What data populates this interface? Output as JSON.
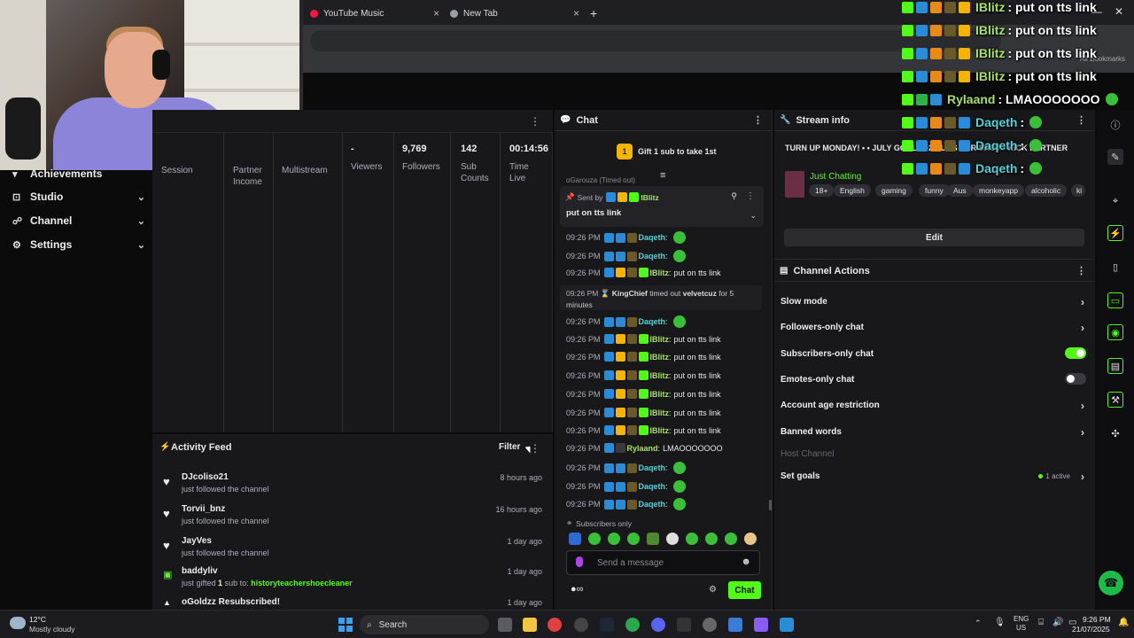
{
  "tabs": [
    {
      "label": "YouTube Music",
      "color": "#ff1744"
    },
    {
      "label": "New Tab",
      "color": "#9aa0a6"
    }
  ],
  "bookmarks_label": "All Bookmarks",
  "sidebar": {
    "items": [
      {
        "label": "Achievements",
        "icon": "trophy-icon"
      },
      {
        "label": "Studio",
        "icon": "studio-icon"
      },
      {
        "label": "Channel",
        "icon": "people-icon"
      },
      {
        "label": "Settings",
        "icon": "gear-icon"
      }
    ]
  },
  "stats": {
    "columns": [
      {
        "value": "",
        "label": "Session"
      },
      {
        "value": "",
        "label": "Partner Income"
      },
      {
        "value": "",
        "label": "Multistream"
      },
      {
        "value": "-",
        "label": "Viewers"
      },
      {
        "value": "9,769",
        "label": "Followers"
      },
      {
        "value": "142",
        "label": "Sub Counts"
      },
      {
        "value": "00:14:56",
        "label": "Time Live"
      }
    ]
  },
  "activity": {
    "title": "Activity Feed",
    "filter_label": "Filter",
    "items": [
      {
        "name": "DJcoliso21",
        "desc": "just followed the channel",
        "time": "8 hours ago",
        "kind": "follow"
      },
      {
        "name": "Torvii_bnz",
        "desc": "just followed the channel",
        "time": "16 hours ago",
        "kind": "follow"
      },
      {
        "name": "JayVes",
        "desc": "just followed the channel",
        "time": "1 day ago",
        "kind": "follow"
      },
      {
        "name": "baddyliv",
        "desc_prefix": "just gifted",
        "desc_count": "1",
        "desc_mid": "sub to:",
        "desc_target": "historyteachershoecleaner",
        "time": "1 day ago",
        "kind": "gift"
      },
      {
        "name": "oGoldzz Resubscribed!",
        "desc": "",
        "time": "1 day ago",
        "kind": "resub"
      }
    ]
  },
  "chat": {
    "title": "Chat",
    "gift_label": "Gift 1 sub to take 1st",
    "gift_rank": "1",
    "truncated_line": "oGarouza (Timed out)",
    "pinned": {
      "sent_by": "Sent by",
      "user": "IBlitz",
      "message": "put on tts link"
    },
    "messages": [
      {
        "time": "09:26 PM",
        "user": "Daqeth",
        "text": "",
        "color": "#5ad1d8",
        "emote": true
      },
      {
        "time": "09:26 PM",
        "user": "Daqeth",
        "text": "",
        "color": "#5ad1d8",
        "emote": true
      },
      {
        "time": "09:26 PM",
        "user": "IBlitz",
        "text": "put on tts link",
        "color": "#a8e06a",
        "emote": false
      },
      {
        "time": "09:26 PM",
        "user": "Daqeth",
        "text": "",
        "color": "#5ad1d8",
        "emote": true
      },
      {
        "time": "09:26 PM",
        "user": "IBlitz",
        "text": "put on tts link",
        "color": "#a8e06a",
        "emote": false
      },
      {
        "time": "09:26 PM",
        "user": "IBlitz",
        "text": "put on tts link",
        "color": "#a8e06a",
        "emote": false
      },
      {
        "time": "09:26 PM",
        "user": "IBlitz",
        "text": "put on tts link",
        "color": "#a8e06a",
        "emote": false
      },
      {
        "time": "09:26 PM",
        "user": "IBlitz",
        "text": "put on tts link",
        "color": "#a8e06a",
        "emote": false
      },
      {
        "time": "09:26 PM",
        "user": "IBlitz",
        "text": "put on tts link",
        "color": "#a8e06a",
        "emote": false
      },
      {
        "time": "09:26 PM",
        "user": "IBlitz",
        "text": "put on tts link",
        "color": "#a8e06a",
        "emote": false
      },
      {
        "time": "09:26 PM",
        "user": "Rylaand",
        "text": "LMAOOOOOOO",
        "color": "#a8e06a",
        "emote": false
      },
      {
        "time": "09:26 PM",
        "user": "Daqeth",
        "text": "",
        "color": "#5ad1d8",
        "emote": true
      },
      {
        "time": "09:26 PM",
        "user": "Daqeth",
        "text": "",
        "color": "#5ad1d8",
        "emote": true
      },
      {
        "time": "09:26 PM",
        "user": "Daqeth",
        "text": "",
        "color": "#5ad1d8",
        "emote": true
      }
    ],
    "timeout": {
      "time": "09:26 PM",
      "mod": "KingChief",
      "action": "timed out",
      "target": "velvetcuz",
      "duration": "for 5 minutes"
    },
    "subscribers_only": "Subscribers only",
    "input_placeholder": "Send a message",
    "send_label": "Chat"
  },
  "stream_info": {
    "title": "Stream info",
    "stream_title": "TURN UP MONDAY! • • JULY GOAL • +2 SUBS FOR SHOT • KICK PARTNER",
    "category": "Just Chatting",
    "tags": [
      "18+",
      "English",
      "gaming",
      "funny",
      "Aus",
      "monkeyapp",
      "alcoholic",
      "ki"
    ],
    "edit_label": "Edit"
  },
  "channel_actions": {
    "title": "Channel Actions",
    "items": [
      {
        "label": "Slow mode",
        "type": "chevron"
      },
      {
        "label": "Followers-only chat",
        "type": "chevron"
      },
      {
        "label": "Subscribers-only chat",
        "type": "toggle",
        "on": true
      },
      {
        "label": "Emotes-only chat",
        "type": "toggle",
        "on": false
      },
      {
        "label": "Account age restriction",
        "type": "chevron"
      },
      {
        "label": "Banned words",
        "type": "chevron"
      },
      {
        "label": "Host Channel",
        "type": "disabled"
      },
      {
        "label": "Set goals",
        "type": "chevron",
        "badge": "1 active"
      }
    ]
  },
  "overlay": [
    {
      "user": "IBlitz",
      "text": ": put on tts link"
    },
    {
      "user": "IBlitz",
      "text": ": put on tts link"
    },
    {
      "user": "IBlitz",
      "text": ": put on tts link"
    },
    {
      "user": "IBlitz",
      "text": ": put on tts link"
    },
    {
      "user": "Rylaand",
      "text": ": LMAOOOOOOO"
    },
    {
      "user": "Daqeth",
      "text": ":"
    },
    {
      "user": "Daqeth",
      "text": ":"
    },
    {
      "user": "Daqeth",
      "text": ":"
    }
  ],
  "taskbar": {
    "weather_temp": "12°C",
    "weather_desc": "Mostly cloudy",
    "search_label": "Search",
    "lang_top": "ENG",
    "lang_bottom": "US",
    "time": "9:26 PM",
    "date": "21/07/2025"
  },
  "colors": {
    "accent": "#53fc18",
    "panel": "#18181b",
    "bg": "#0b0b0c"
  }
}
